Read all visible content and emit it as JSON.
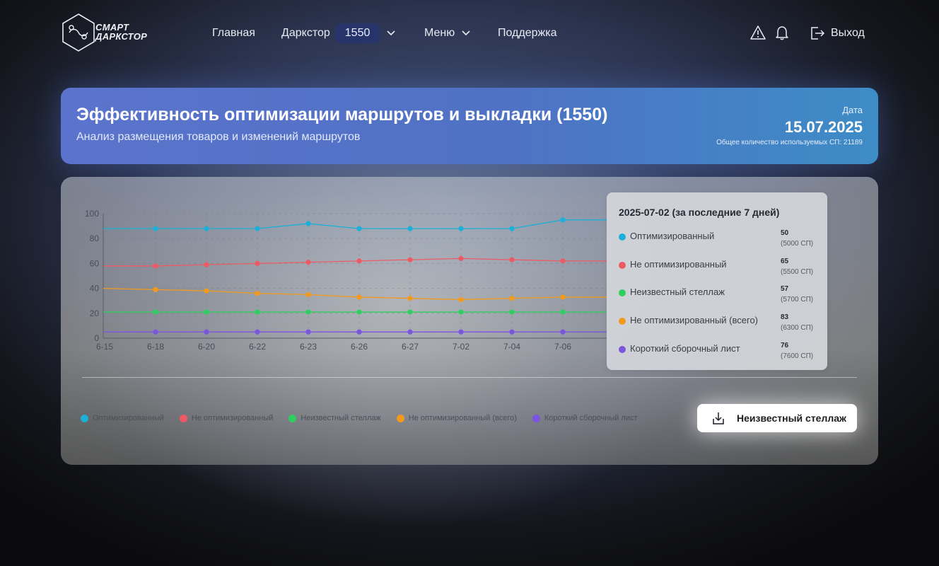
{
  "header": {
    "logo": {
      "line1": "СМАРТ",
      "line2": "ДАРКСТОР"
    },
    "nav": {
      "home": "Главная",
      "darkstore_label": "Даркстор",
      "darkstore_value": "1550",
      "menu": "Меню",
      "support": "Поддержка"
    },
    "icons": [
      "alert-triangle-icon",
      "bell-icon",
      "logout-icon"
    ],
    "logout": "Выход"
  },
  "banner": {
    "title": "Эффективность оптимизации маршрутов и выкладки (1550)",
    "subtitle": "Анализ размещения товаров и изменений маршрутов",
    "date_label": "Дата",
    "date_value": "15.07.2025",
    "note": "Общее количество используемых СП: 21189"
  },
  "tooltip": {
    "title": "2025-07-02 (за последние 7 дней)",
    "rows": [
      {
        "name": "Оптимизированный",
        "value": "50",
        "sub": "(5000 СП)",
        "color": "#1ab0d8"
      },
      {
        "name": "Не оптимизированный",
        "value": "65",
        "sub": "(5500 СП)",
        "color": "#ee5a64"
      },
      {
        "name": "Неизвестный стеллаж",
        "value": "57",
        "sub": "(5700 СП)",
        "color": "#2fcf5f"
      },
      {
        "name": "Не оптимизированный (всего)",
        "value": "83",
        "sub": "(6300 СП)",
        "color": "#f39a1c"
      },
      {
        "name": "Короткий сборочный лист",
        "value": "76",
        "sub": "(7600 СП)",
        "color": "#7b55e0"
      }
    ]
  },
  "export_button": "Неизвестный стеллаж",
  "chart_data": {
    "type": "line",
    "x": [
      "6-15",
      "6-18",
      "6-20",
      "6-22",
      "6-23",
      "6-26",
      "6-27",
      "7-02",
      "7-04",
      "7-06"
    ],
    "ylim": [
      0,
      100
    ],
    "yticks": [
      0,
      20,
      40,
      60,
      80,
      100
    ],
    "grid": true,
    "legend": "bottom-left",
    "series": [
      {
        "name": "Оптимизированный",
        "color": "#1ab0d8",
        "values": [
          88,
          88,
          88,
          88,
          92,
          88,
          88,
          88,
          88,
          95
        ]
      },
      {
        "name": "Не оптимизированный",
        "color": "#ee5a64",
        "values": [
          58,
          58,
          59,
          60,
          61,
          62,
          63,
          64,
          63,
          62
        ]
      },
      {
        "name": "Неизвестный стеллаж",
        "color": "#2fcf5f",
        "values": [
          21,
          21,
          21,
          21,
          21,
          21,
          21,
          21,
          21,
          21
        ]
      },
      {
        "name": "Не оптимизированный (всего)",
        "color": "#f39a1c",
        "values": [
          40,
          39,
          38,
          36,
          35,
          33,
          32,
          31,
          32,
          33
        ]
      },
      {
        "name": "Короткий сборочный лист",
        "color": "#7b55e0",
        "values": [
          5,
          5,
          5,
          5,
          5,
          5,
          5,
          5,
          5,
          5
        ]
      }
    ]
  }
}
